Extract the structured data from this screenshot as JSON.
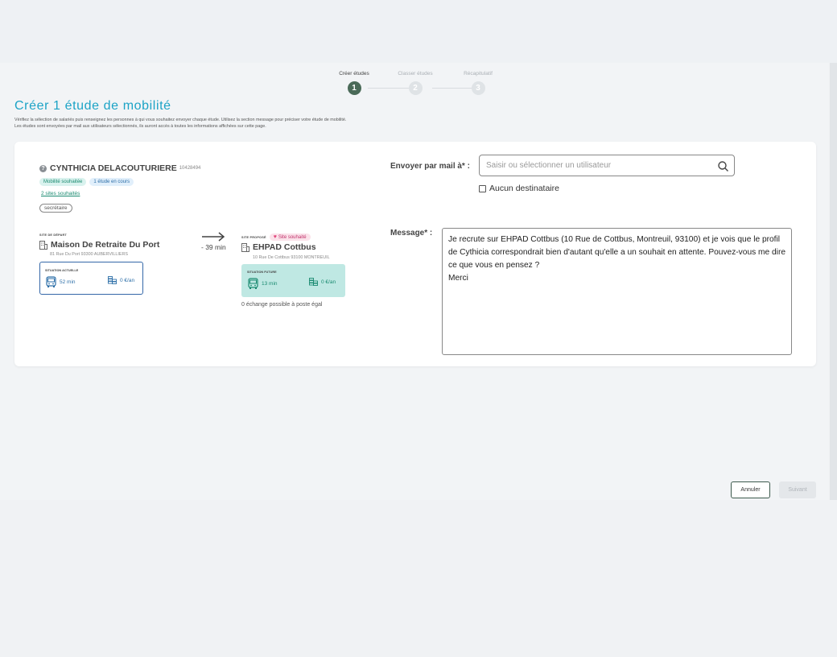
{
  "stepper": {
    "steps": [
      {
        "label": "Créer études",
        "number": "1",
        "active": true
      },
      {
        "label": "Classer études",
        "number": "2",
        "active": false
      },
      {
        "label": "Récapitulatif",
        "number": "3",
        "active": false
      }
    ]
  },
  "header": {
    "title": "Créer 1 étude de mobilité",
    "subtitle_line1": "Vérifiez la sélection de salariés puis renseignez les personnes à qui vous souhaitez envoyer chaque étude. Utilisez la section message pour préciser votre étude de mobilité.",
    "subtitle_line2": "Les études sont envoyées par mail aux utilisateurs sélectionnés, ils auront accès à toutes les informations affichées sur cette page."
  },
  "employee": {
    "help_icon": "?",
    "name": "CYNTHICIA DELACOUTURIERE",
    "id": "10428494",
    "badges": [
      "Mobilité souhaitée",
      "1 étude en cours"
    ],
    "sites_link": "2 sites souhaités",
    "job": "secrétaire"
  },
  "departure": {
    "label": "SITE DE DÉPART",
    "name": "Maison De Retraite Du Port",
    "address": "81 Rue Du Port 93300 AUBERVILLIERS",
    "situation_label": "SITUATION ACTUELLE",
    "duration": "52 min",
    "cost": "0 €/an"
  },
  "transfer": {
    "arrow": "→",
    "time_diff": "- 39 min"
  },
  "proposed": {
    "label": "SITE PROPOSÉ",
    "wish_badge": "Site souhaité",
    "name": "EHPAD Cottbus",
    "address": "10 Rue De Cottbus 93100 MONTREUIL",
    "situation_label": "SITUATION FUTURE",
    "duration": "13 min",
    "cost": "0 €/an",
    "exchange": "0 échange possible à poste égal"
  },
  "send": {
    "label": "Envoyer par mail à* :",
    "placeholder": "Saisir ou sélectionner un utilisateur",
    "value": "",
    "no_recipient_label": "Aucun destinataire",
    "no_recipient_checked": false
  },
  "message": {
    "label": "Message* :",
    "text": "Je recrute sur EHPAD Cottbus (10 Rue de Cottbus, Montreuil, 93100) et je vois que le profil de Cythicia correspondrait bien d'autant qu'elle a un souhait en attente. Pouvez-vous me dire ce que vous en pensez ?\nMerci"
  },
  "footer": {
    "cancel_label": "Annuler",
    "next_label": "Suivant"
  },
  "colors": {
    "accent_title": "#1ca3c6",
    "step_active": "#4a6a58",
    "future_box": "#bfe8e3",
    "current_box_border": "#3467a8"
  }
}
